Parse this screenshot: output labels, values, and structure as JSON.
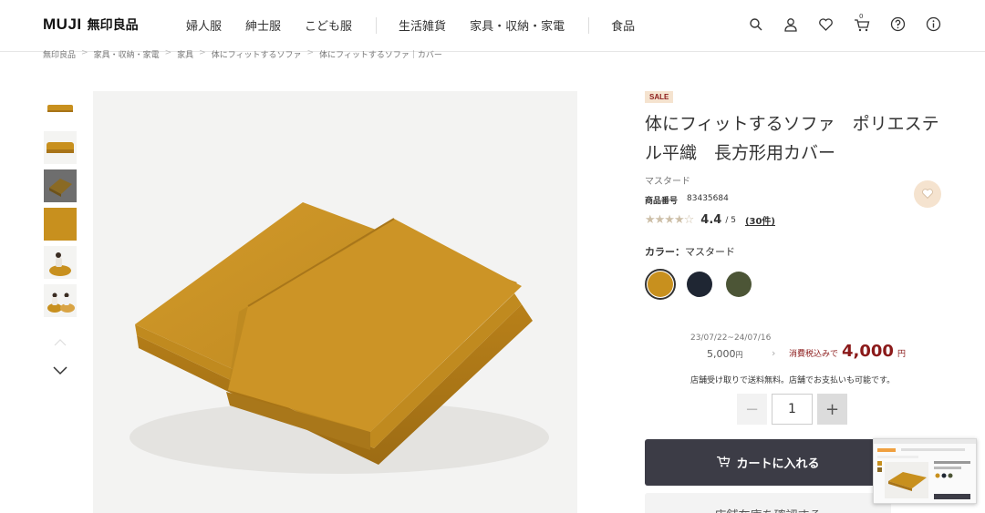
{
  "header": {
    "logo_brand": "MUJI",
    "logo_jp": "無印良品",
    "nav": [
      "婦人服",
      "紳士服",
      "こども服",
      "生活雑貨",
      "家具・収納・家電",
      "食品"
    ],
    "cart_count": "0"
  },
  "breadcrumb": [
    "無印良品",
    "家具・収納・家電",
    "家具",
    "体にフィットするソファ",
    "体にフィットするソファ｜カバー"
  ],
  "product": {
    "sale_badge": "SALE",
    "title": "体にフィットするソファ　ポリエステル平織　長方形用カバー",
    "color_name": "マスタード",
    "product_no_label": "商品番号",
    "product_no": "83435684",
    "rating": "4.4",
    "rating_max": "/ 5",
    "rating_count": "(30件)",
    "stars_value": 4.4,
    "color_label": "カラー：",
    "color_value": "マスタード",
    "swatches": [
      "#c8901e",
      "#1f2633",
      "#4c5536"
    ],
    "date_range": "23/07/22~24/07/16",
    "old_price": "5,000",
    "yen": "円",
    "chevron": "›",
    "tax_label": "消費税込みで",
    "new_price": "4,000",
    "pickup_note": "店舗受け取りで送料無料。店舗でお支払いも可能です。",
    "qty_minus": "−",
    "qty_value": "1",
    "qty_plus": "+",
    "cart_button": "カートに入れる",
    "store_button": "店舗在庫を確認する"
  },
  "colors": {
    "accent_sale": "#8b1a1a",
    "sale_bg": "#f5e3cf",
    "cart_bg": "#3c3c46",
    "mustard": "#c8901e"
  }
}
